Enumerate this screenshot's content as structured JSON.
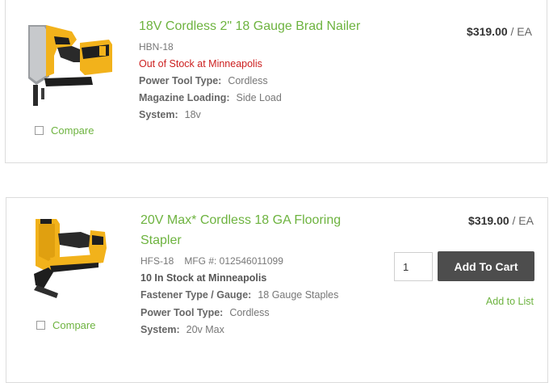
{
  "colors": {
    "brand_green": "#6db33f",
    "out_of_stock_red": "#cc1f1f",
    "button_dark": "#4d4d4d"
  },
  "products": [
    {
      "title": "18V Cordless 2\" 18 Gauge Brad Nailer",
      "sku": "HBN-18",
      "stock_status": "Out of Stock at Minneapolis",
      "specs": [
        {
          "label": "Power Tool Type:",
          "value": "Cordless"
        },
        {
          "label": "Magazine Loading:",
          "value": "Side Load"
        },
        {
          "label": "System:",
          "value": "18v"
        }
      ],
      "price": "$319.00",
      "price_unit": "/ EA",
      "compare_label": "Compare",
      "image_icon": "brad-nailer-image"
    },
    {
      "title_line1": "20V Max* Cordless 18 GA Flooring",
      "title_line2": "Stapler",
      "sku": "HFS-18",
      "mfg": "MFG #: 012546011099",
      "stock_status": "10 In Stock at Minneapolis",
      "specs": [
        {
          "label": "Fastener Type / Gauge:",
          "value": "18 Gauge Staples"
        },
        {
          "label": "Power Tool Type:",
          "value": "Cordless"
        },
        {
          "label": "System:",
          "value": "20v Max"
        }
      ],
      "price": "$319.00",
      "price_unit": "/ EA",
      "quantity": "1",
      "add_to_cart_label": "Add To Cart",
      "add_to_list_label": "Add to List",
      "compare_label": "Compare",
      "image_icon": "flooring-stapler-image"
    }
  ]
}
